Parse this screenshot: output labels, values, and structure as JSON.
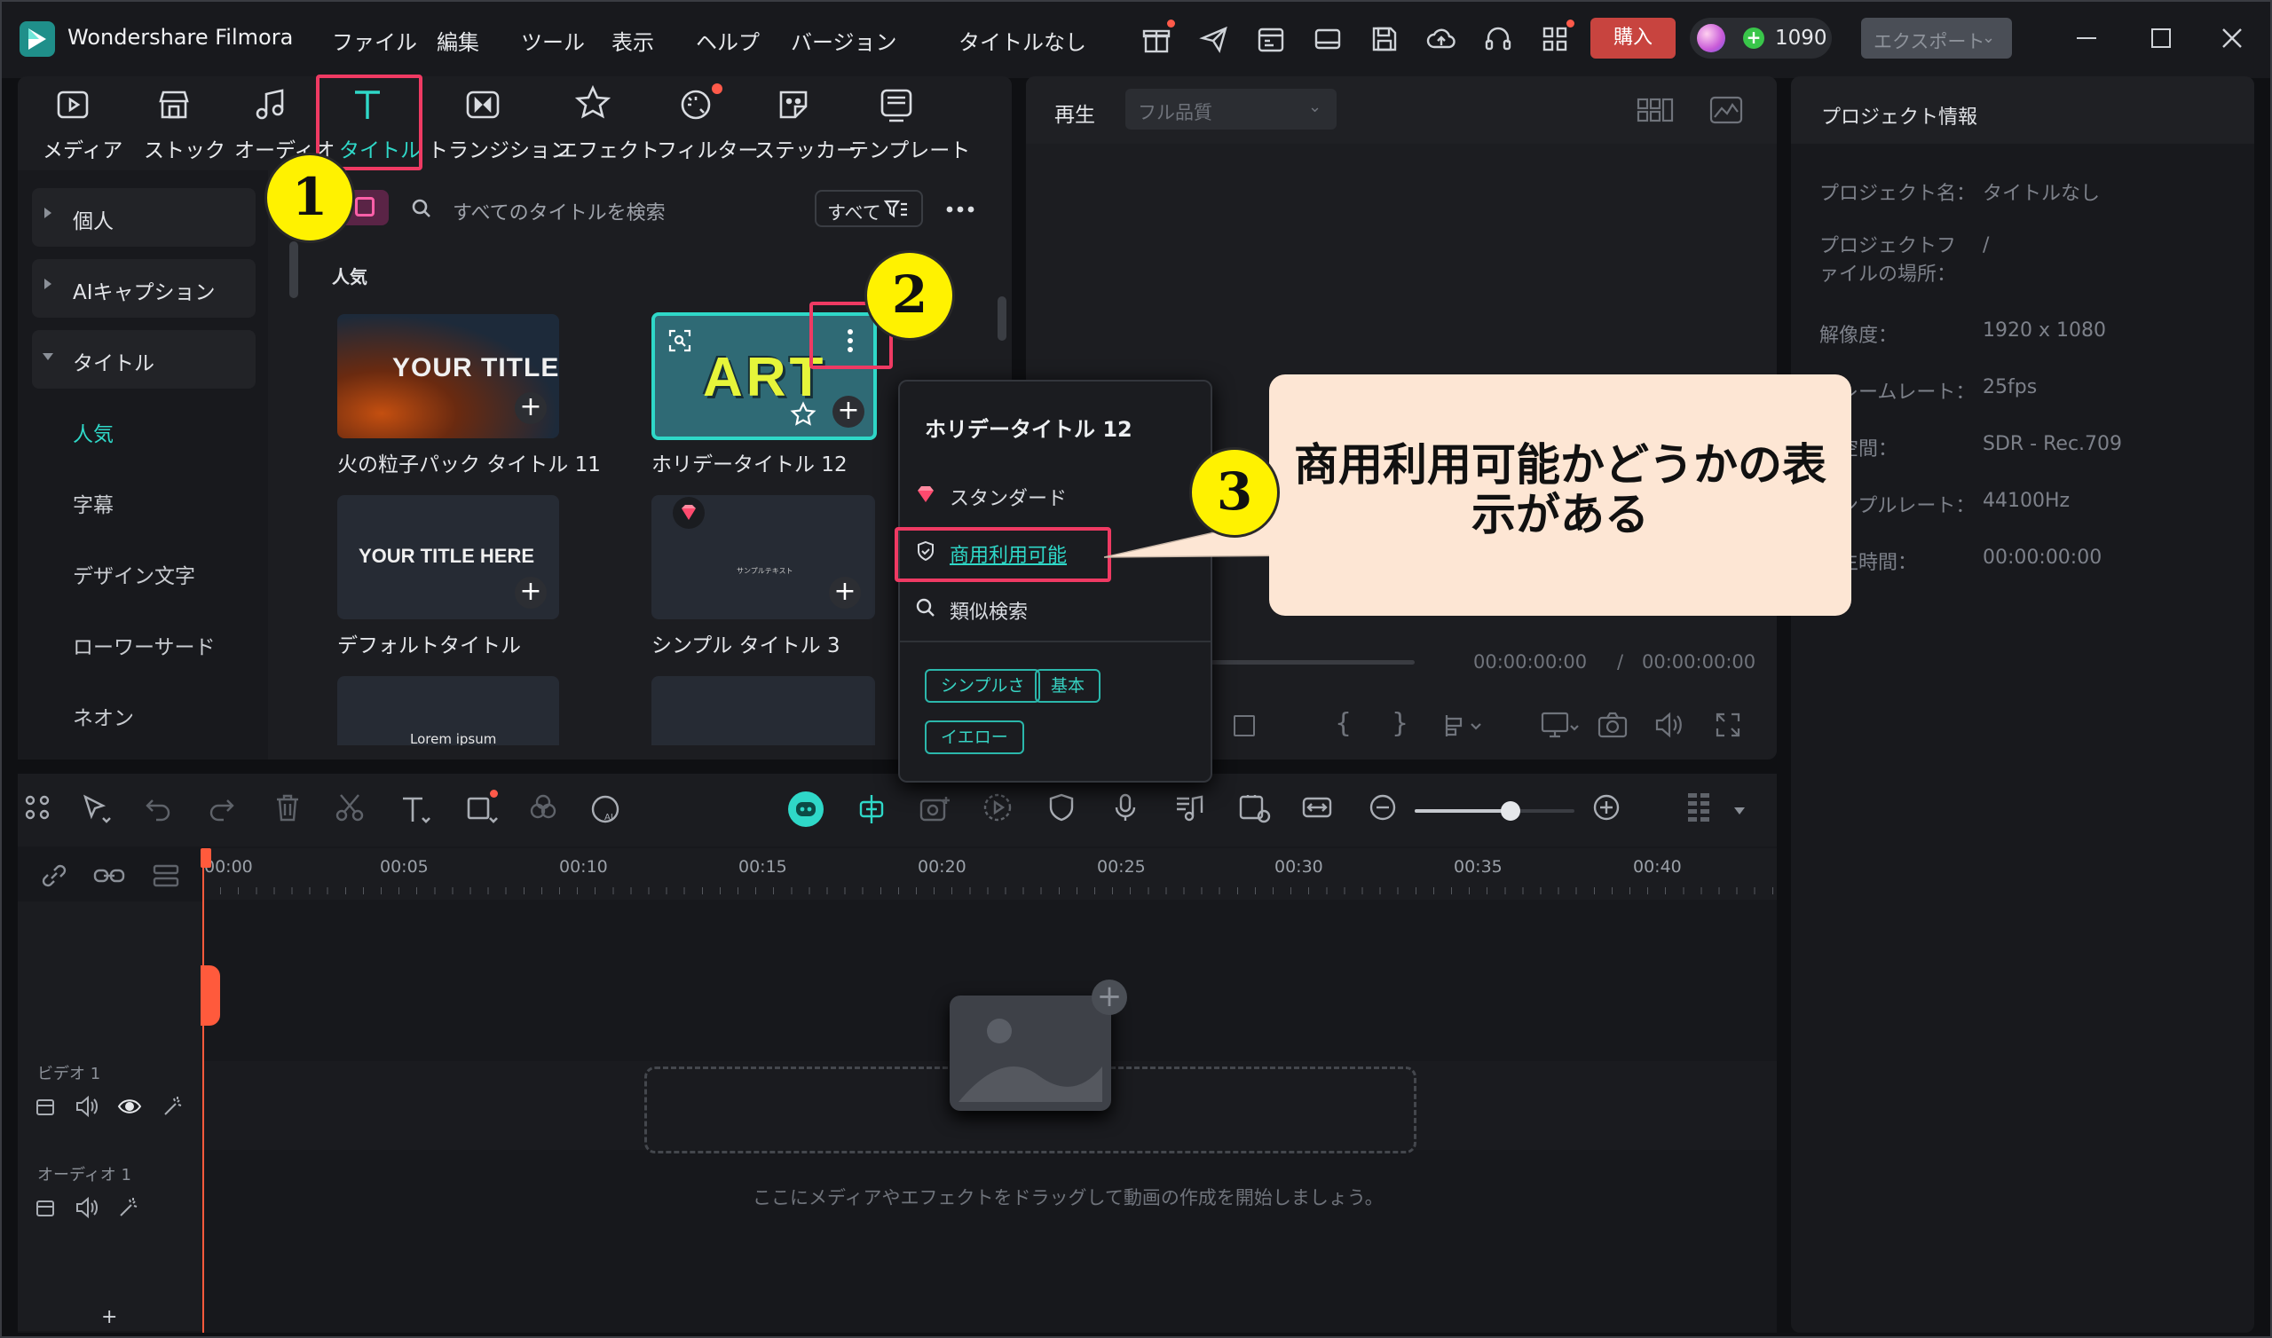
{
  "app": {
    "name": "Wondershare Filmora",
    "title": "タイトルなし",
    "credits": "1090",
    "buy_label": "購入",
    "export_label": "エクスポート"
  },
  "menu": [
    "ファイル",
    "編集",
    "ツール",
    "表示",
    "ヘルプ",
    "バージョン"
  ],
  "toolbar": [
    {
      "label": "メディア",
      "icon": "media-icon"
    },
    {
      "label": "ストック",
      "icon": "stock-icon"
    },
    {
      "label": "オーディオ",
      "icon": "audio-icon"
    },
    {
      "label": "タイトル",
      "icon": "title-t-icon"
    },
    {
      "label": "トランジション",
      "icon": "transition-icon"
    },
    {
      "label": "エフェクト",
      "icon": "effect-icon"
    },
    {
      "label": "フィルター",
      "icon": "filter-icon"
    },
    {
      "label": "ステッカー",
      "icon": "sticker-icon"
    },
    {
      "label": "テンプレート",
      "icon": "template-icon"
    }
  ],
  "sidebar": {
    "groups": [
      "個人",
      "AIキャプション",
      "タイトル"
    ],
    "items": [
      "人気",
      "字幕",
      "デザイン文字",
      "ローワーサード",
      "ネオン"
    ]
  },
  "search": {
    "placeholder": "すべてのタイトルを検索",
    "filter_label": "すべて"
  },
  "section_title": "人気",
  "thumbs": [
    {
      "caption": "火の粒子パック タイトル 11",
      "art": "YOUR TITLE"
    },
    {
      "caption": "ホリデータイトル 12",
      "art": "ART"
    },
    {
      "caption": "デフォルトタイトル",
      "art": "YOUR TITLE HERE"
    },
    {
      "caption": "シンプル タイトル 3",
      "art": "サンプルテキスト"
    },
    {
      "caption": "",
      "art": "Lorem ipsum"
    },
    {
      "caption": "",
      "art": ""
    }
  ],
  "context_menu": {
    "title": "ホリデータイトル 12",
    "standard": "スタンダード",
    "commercial": "商用利用可能",
    "similar": "類似検索",
    "tags": [
      "シンプルさ",
      "基本",
      "イエロー"
    ]
  },
  "player": {
    "label": "再生",
    "quality": "フル品質",
    "time_current": "00:00:00:00",
    "time_sep": "/",
    "time_total": "00:00:00:00"
  },
  "project_info": {
    "title": "プロジェクト情報",
    "rows": [
      {
        "label": "プロジェクト名：",
        "value": "タイトルなし"
      },
      {
        "label": "プロジェクトファイルの場所：",
        "value": "/"
      },
      {
        "label": "解像度：",
        "value": "1920 x 1080"
      },
      {
        "label": "フレームレート：",
        "value": "25fps"
      },
      {
        "label": "色空間：",
        "value": "SDR - Rec.709"
      },
      {
        "label": "サンプルレート：",
        "value": "44100Hz"
      },
      {
        "label": "再生時間：",
        "value": "00:00:00:00"
      }
    ]
  },
  "timeline": {
    "ruler": [
      "00:00",
      "00:05",
      "00:10",
      "00:15",
      "00:20",
      "00:25",
      "00:30",
      "00:35",
      "00:40"
    ],
    "tracks": [
      "ビデオ 1",
      "オーディオ 1"
    ],
    "drop_hint": "ここにメディアやエフェクトをドラッグして動画の作成を開始しましょう。",
    "zoom_level": 0.6
  },
  "annotations": {
    "steps": [
      "1",
      "2",
      "3"
    ],
    "callout": "商用利用可能かどうかの表示がある"
  },
  "colors": {
    "accent": "#2fd8c8",
    "highlight": "#ef3a63",
    "buy": "#c8443f",
    "callout_bg": "#fde6d4",
    "marker": "#fff200"
  }
}
